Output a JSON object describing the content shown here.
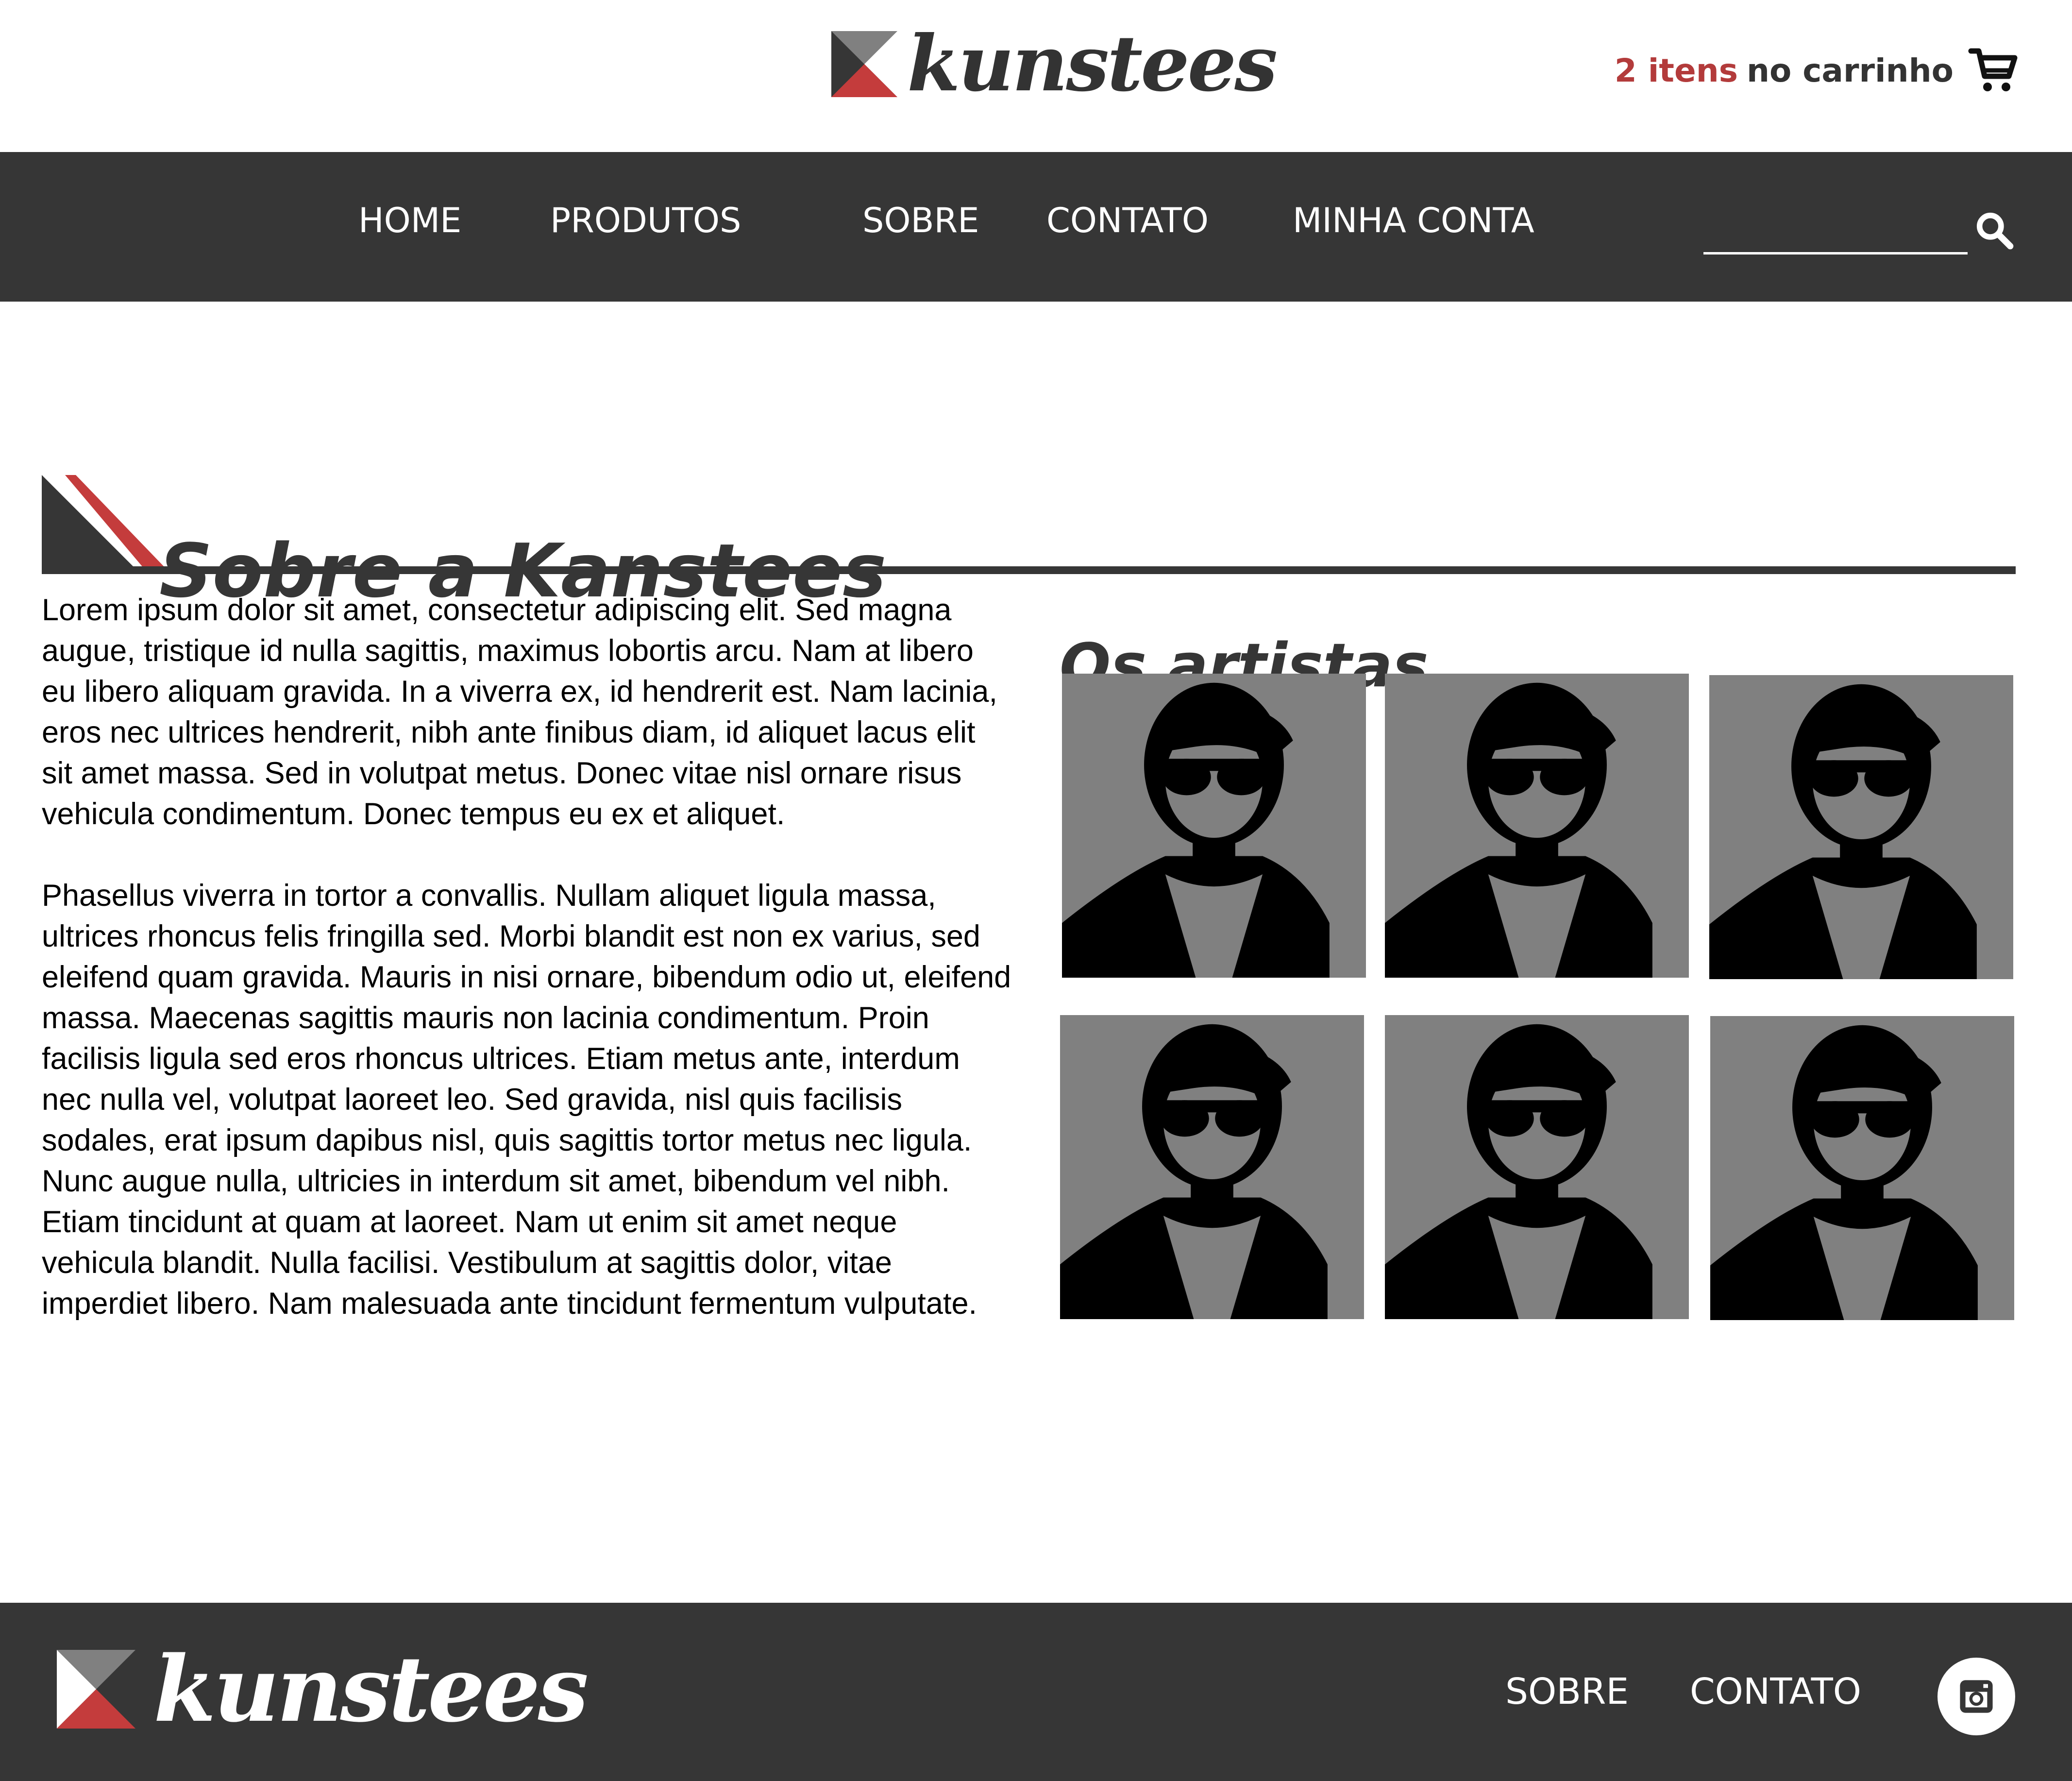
{
  "brand": {
    "name": "kunstees"
  },
  "cart": {
    "count_label": "2 itens",
    "rest_label": "no carrinho",
    "icon": "shopping-cart-icon"
  },
  "nav": {
    "items": [
      {
        "label": "HOME"
      },
      {
        "label": "PRODUTOS"
      },
      {
        "label": "SOBRE"
      },
      {
        "label": "CONTATO"
      },
      {
        "label": "MINHA CONTA"
      }
    ],
    "search": {
      "placeholder": "",
      "value": "",
      "icon": "search-icon"
    }
  },
  "page": {
    "title": "Sobre a Kanstees",
    "paragraphs": [
      "Lorem ipsum dolor sit amet, consectetur adipiscing elit. Sed magna augue, tristique id nulla sagittis, maximus lobortis arcu. Nam at libero eu libero aliquam gravida. In a viverra ex, id hendrerit est. Nam lacinia, eros nec ultrices hendrerit, nibh ante finibus diam, id aliquet lacus elit sit amet massa. Sed in volutpat metus. Donec vitae nisl ornare risus vehicula condimentum. Donec tempus eu ex et aliquet.",
      "Phasellus viverra in tortor a convallis. Nullam aliquet ligula massa, ultrices rhoncus felis fringilla sed. Morbi blandit est non ex varius, sed eleifend quam gravida. Mauris in nisi ornare, bibendum odio ut, eleifend massa. Maecenas sagittis mauris non lacinia condimentum. Proin facilisis ligula sed eros rhoncus ultrices. Etiam metus ante, interdum nec nulla vel, volutpat laoreet leo. Sed gravida, nisl quis facilisis sodales, erat ipsum dapibus nisl, quis sagittis tortor metus nec ligula. Nunc augue nulla, ultricies in interdum sit amet, bibendum vel nibh. Etiam tincidunt at quam at laoreet. Nam ut enim sit amet neque vehicula blandit. Nulla facilisi. Vestibulum at sagittis dolor, vitae imperdiet libero. Nam malesuada ante tincidunt fermentum vulputate."
    ]
  },
  "artists": {
    "title": "Os artistas",
    "items": [
      {
        "icon": "artist-avatar-icon"
      },
      {
        "icon": "artist-avatar-icon"
      },
      {
        "icon": "artist-avatar-icon"
      },
      {
        "icon": "artist-avatar-icon"
      },
      {
        "icon": "artist-avatar-icon"
      },
      {
        "icon": "artist-avatar-icon"
      }
    ]
  },
  "footer": {
    "links": [
      {
        "label": "SOBRE"
      },
      {
        "label": "CONTATO"
      }
    ],
    "social_icon": "instagram-icon"
  },
  "colors": {
    "accent_red": "#b33b3b",
    "dark": "#363636",
    "logo_grey": "#808080",
    "avatar_bg": "#808080"
  }
}
